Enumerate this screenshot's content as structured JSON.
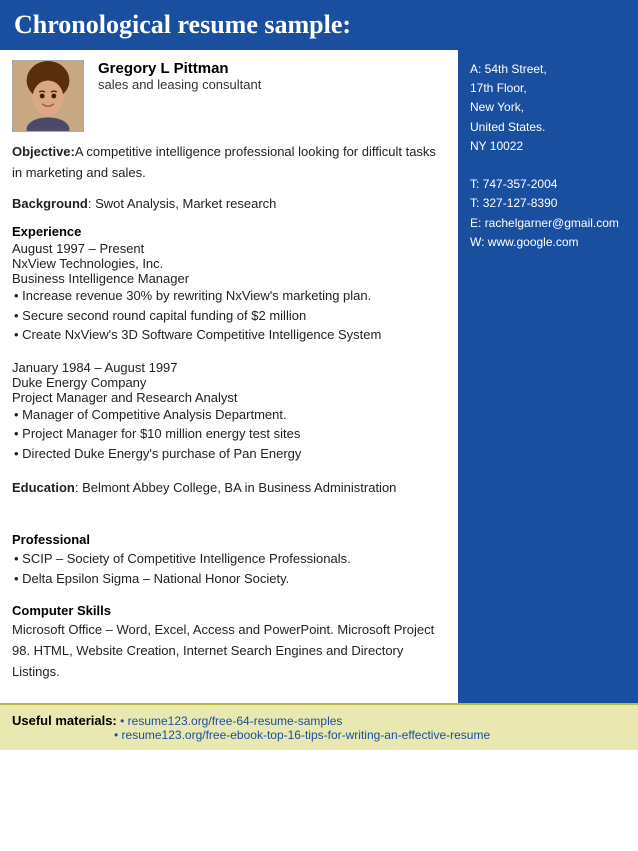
{
  "page": {
    "title": "Chronological resume sample:"
  },
  "header": {
    "name": "Gregory L Pittman",
    "role": "sales and leasing consultant"
  },
  "contact": {
    "address_line1": "A: 54th Street,",
    "address_line2": "17th Floor,",
    "address_line3": "New York,",
    "address_line4": "United States.",
    "address_line5": "NY 10022",
    "phone1_label": "T:",
    "phone1": "747-357-2004",
    "phone2_label": "T:",
    "phone2": "327-127-8390",
    "email_label": "E:",
    "email": "rachelgarner@gmail.com",
    "web_label": "W:",
    "web": "www.google.com"
  },
  "objective": {
    "label": "Objective:",
    "text": "A competitive intelligence professional looking for difficult tasks in marketing and sales."
  },
  "background": {
    "label": "Background",
    "text": ": Swot Analysis, Market research"
  },
  "experience": {
    "heading": "Experience",
    "jobs": [
      {
        "date": "August 1997 – Present",
        "company": "NxView Technologies, Inc.",
        "role": "Business Intelligence Manager",
        "bullets": [
          "• Increase revenue 30% by rewriting NxView's marketing plan.",
          "• Secure second round capital funding of $2 million",
          "• Create NxView's 3D Software Competitive Intelligence System"
        ]
      },
      {
        "date": "January 1984 – August 1997",
        "company": "Duke Energy Company",
        "role": "Project Manager and Research Analyst",
        "bullets": [
          "• Manager of Competitive Analysis Department.",
          "• Project Manager for $10 million energy test sites",
          "• Directed Duke Energy's purchase of Pan Energy"
        ]
      }
    ]
  },
  "education": {
    "label": "Education",
    "text": ": Belmont Abbey College, BA in Business Administration"
  },
  "professional": {
    "heading": "Professional",
    "bullets": [
      "• SCIP – Society of Competitive Intelligence Professionals.",
      "• Delta Epsilon Sigma – National Honor Society."
    ]
  },
  "computer_skills": {
    "heading": "Computer Skills",
    "text": "Microsoft Office – Word, Excel, Access and PowerPoint. Microsoft Project 98. HTML, Website Creation, Internet Search Engines and Directory Listings."
  },
  "footer": {
    "label": "Useful materials:",
    "links": [
      "• resume123.org/free-64-resume-samples",
      "• resume123.org/free-ebook-top-16-tips-for-writing-an-effective-resume"
    ]
  }
}
